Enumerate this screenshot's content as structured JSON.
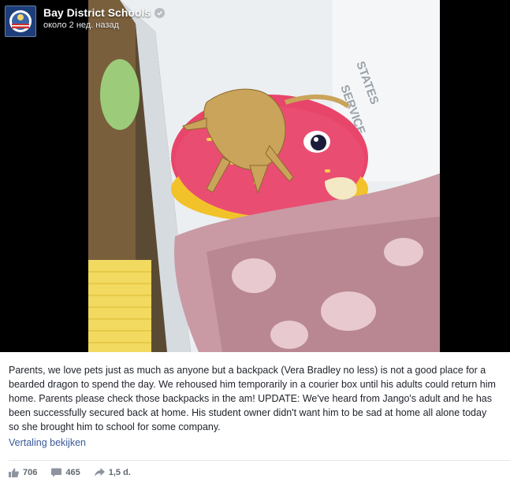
{
  "post": {
    "page_name": "Bay District Schools",
    "timestamp": "около 2 нед. назад",
    "verified_icon": "verified-check-icon",
    "body_lines": [
      "Parents, we love pets just as much as anyone but a backpack (Vera Bradley no less) is not a good place for a",
      "bearded dragon to spend the day. We rehoused him temporarily in a courier box until his adults could return him",
      "home. Parents please check those backpacks in the am! UPDATE: We've heard from Jango's adult and he has",
      "been successfully secured back at home. His student owner didn't want him to be sad at home all alone today",
      "so she brought him to school for some company."
    ],
    "see_translation": "Vertaling bekijken"
  },
  "stats": {
    "likes": "706",
    "comments": "465",
    "shares": "1,5 d."
  },
  "colors": {
    "link": "#385898",
    "text": "#1d2129",
    "photo_background": "#000000"
  }
}
